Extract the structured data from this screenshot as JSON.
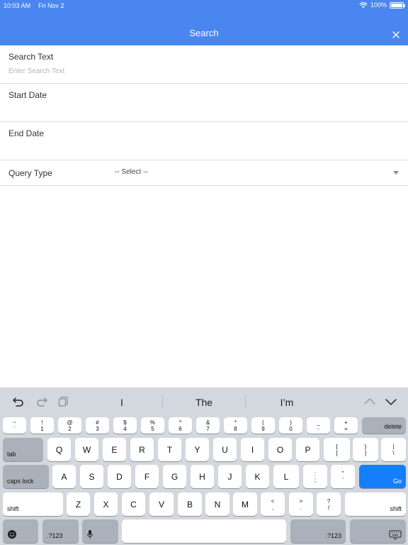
{
  "status_bar": {
    "time": "10:03 AM",
    "date": "Fri Nov 2",
    "battery_text": "100%",
    "battery_level": 1.0,
    "wifi_icon": "wifi-icon"
  },
  "header": {
    "title": "Search",
    "close_icon": "close-icon",
    "background": "#4a86f0"
  },
  "form": {
    "search_text": {
      "label": "Search Text",
      "value": "",
      "placeholder": "Enter Search Text"
    },
    "start_date": {
      "label": "Start Date",
      "value": ""
    },
    "end_date": {
      "label": "End Date",
      "value": ""
    },
    "query_type": {
      "label": "Query Type",
      "selected": "-- Select --"
    }
  },
  "keyboard": {
    "suggestions": [
      "I",
      "The",
      "I’m"
    ],
    "number_row": [
      {
        "top": "~",
        "bottom": "`"
      },
      {
        "top": "!",
        "bottom": "1"
      },
      {
        "top": "@",
        "bottom": "2"
      },
      {
        "top": "$",
        "bottom": "4"
      },
      {
        "top": "%",
        "bottom": "5"
      },
      {
        "top": "^",
        "bottom": "6"
      },
      {
        "top": "&",
        "bottom": "7"
      },
      {
        "top": "*",
        "bottom": "8"
      },
      {
        "top": "(",
        "bottom": "9"
      },
      {
        "top": ")",
        "bottom": "0"
      },
      {
        "top": "_",
        "bottom": "-"
      },
      {
        "top": "+",
        "bottom": "="
      }
    ],
    "extra_hash": {
      "top": "#",
      "bottom": "3"
    },
    "delete_label": "delete",
    "tab_label": "tab",
    "row_q": [
      "Q",
      "W",
      "E",
      "R",
      "T",
      "Y",
      "U",
      "I",
      "O",
      "P"
    ],
    "row_q_symbols": [
      {
        "top": "{",
        "bottom": "["
      },
      {
        "top": "}",
        "bottom": "]"
      },
      {
        "top": "|",
        "bottom": "\\"
      }
    ],
    "caps_label": "caps lock",
    "row_a": [
      "A",
      "S",
      "D",
      "F",
      "G",
      "H",
      "J",
      "K",
      "L"
    ],
    "row_a_symbols": [
      {
        "top": ":",
        "bottom": ";"
      },
      {
        "top": "”",
        "bottom": "’"
      }
    ],
    "go_label": "Go",
    "shift_label": "shift",
    "row_z": [
      "Z",
      "X",
      "C",
      "V",
      "B",
      "N",
      "M"
    ],
    "row_z_symbols": [
      {
        "top": "<",
        "bottom": ","
      },
      {
        "top": ">",
        "bottom": "."
      },
      {
        "top": "?",
        "bottom": "/"
      }
    ],
    "num_label": ".?123",
    "emoji_icon": "emoji-icon",
    "mic_icon": "microphone-icon",
    "hide_keyboard_icon": "keyboard-hide-icon",
    "accent_color": "#147efb"
  }
}
